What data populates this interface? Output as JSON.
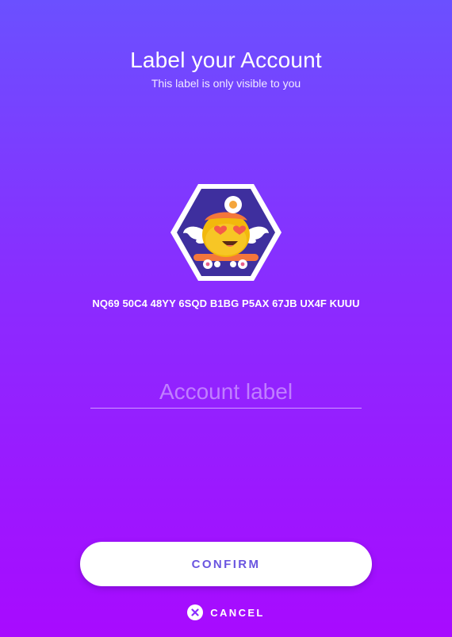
{
  "header": {
    "title": "Label your Account",
    "subtitle": "This label is only visible to you"
  },
  "account": {
    "address": "NQ69 50C4 48YY 6SQD B1BG P5AX 67JB UX4F KUUU",
    "avatar_icon": "account-identicon"
  },
  "label_input": {
    "value": "",
    "placeholder": "Account label"
  },
  "actions": {
    "confirm_label": "CONFIRM",
    "cancel_label": "CANCEL",
    "cancel_icon": "close-circle-icon"
  },
  "colors": {
    "gradient_top": "#6b50ff",
    "gradient_bottom": "#a80aff",
    "confirm_text": "#6a55e0",
    "button_bg": "#ffffff"
  }
}
